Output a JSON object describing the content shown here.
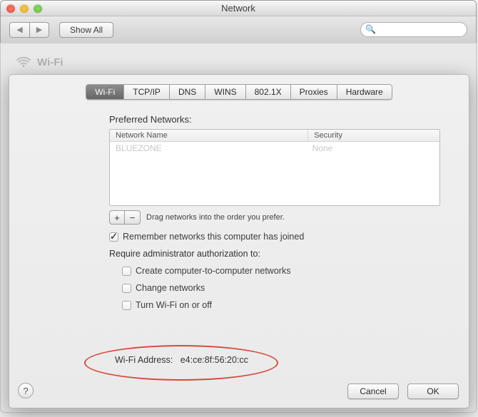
{
  "window": {
    "title": "Network"
  },
  "toolbar": {
    "show_all": "Show All",
    "search_placeholder": ""
  },
  "background": {
    "wifi_label": "Wi-Fi"
  },
  "tabs": {
    "items": [
      "Wi-Fi",
      "TCP/IP",
      "DNS",
      "WINS",
      "802.1X",
      "Proxies",
      "Hardware"
    ],
    "active_index": 0
  },
  "panel": {
    "preferred_networks_label": "Preferred Networks:",
    "table": {
      "columns": {
        "name": "Network Name",
        "security": "Security"
      },
      "rows": [
        {
          "name": "BLUEZONE",
          "security": "None"
        }
      ]
    },
    "drag_hint": "Drag networks into the order you prefer.",
    "remember_label": "Remember networks this computer has joined",
    "remember_checked": true,
    "require_label": "Require administrator authorization to:",
    "option_create": "Create computer-to-computer networks",
    "option_change": "Change networks",
    "option_toggle": "Turn Wi-Fi on or off"
  },
  "address": {
    "label": "Wi-Fi Address:",
    "value": "e4:ce:8f:56:20:cc"
  },
  "buttons": {
    "cancel": "Cancel",
    "ok": "OK"
  }
}
